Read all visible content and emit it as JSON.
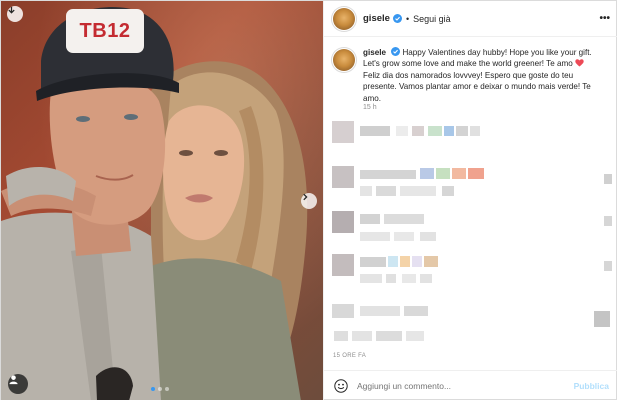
{
  "post": {
    "username": "gisele",
    "follow_label": "Segui già",
    "separator": "•",
    "more_label": "•••",
    "photo_cap_text": "TB12",
    "caption_line1": "Happy Valentines day hubby! Hope you like your gift. Let's grow some love and make the world greener! Te amo",
    "caption_line2": "Feliz dia dos namorados lovvvey! Espero que goste do teu presente. Vamos plantar amor e deixar o mundo mais verde! Te amo.",
    "caption_time": "15 h",
    "post_time": "15 ORE FA",
    "carousel": {
      "count": 3,
      "active_index": 0
    }
  },
  "comment_box": {
    "placeholder": "Aggiungi un commento...",
    "publish_label": "Pubblica"
  },
  "icons": {
    "top_left": "download-icon",
    "bottom_left": "user-tag-icon",
    "carousel_next": "chevron-right-icon",
    "verified": "verified-badge-icon",
    "emoji": "smiley-icon",
    "heart": "red-heart-icon"
  },
  "colors": {
    "verified_blue": "#3897f0",
    "heart_red": "#ed4956",
    "publish_disabled": "#b2dffc",
    "muted_text": "#8e8e8e"
  }
}
